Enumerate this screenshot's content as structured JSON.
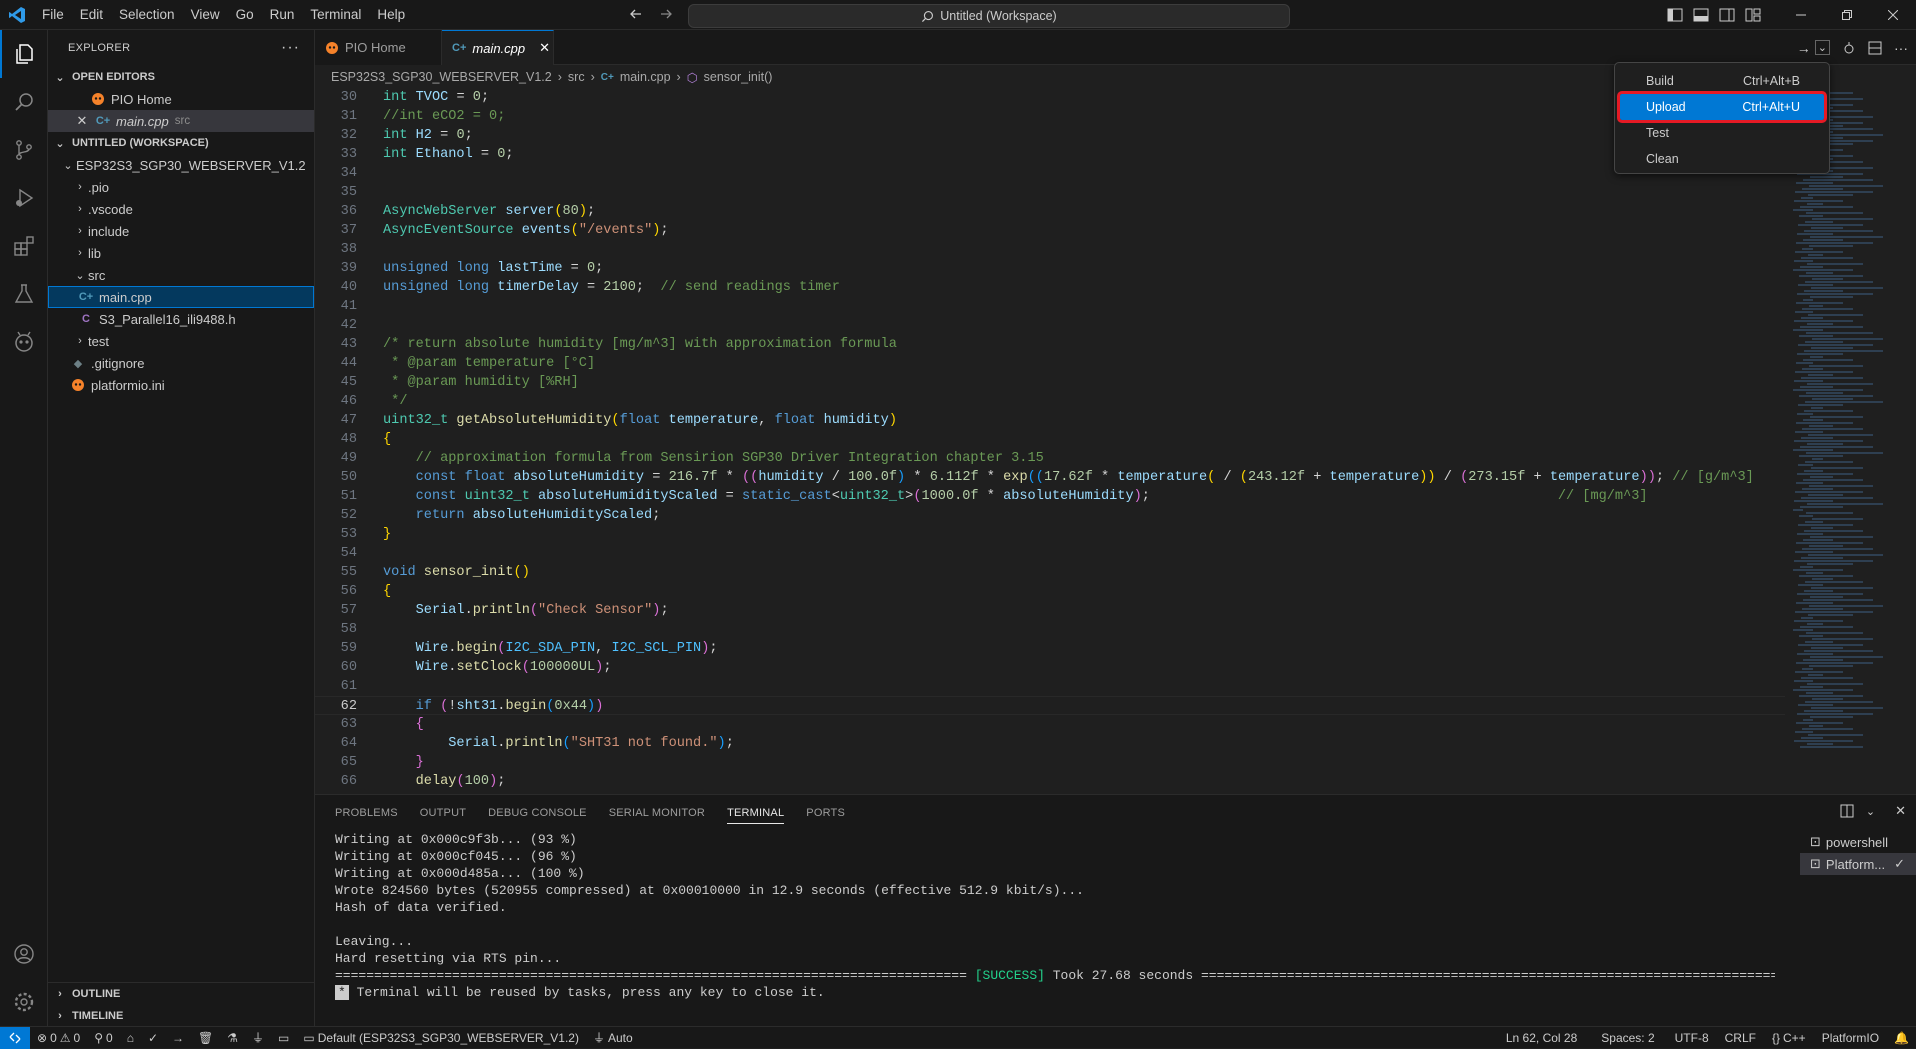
{
  "titlebar": {
    "menus": [
      "File",
      "Edit",
      "Selection",
      "View",
      "Go",
      "Run",
      "Terminal",
      "Help"
    ],
    "search_text": "Untitled (Workspace)"
  },
  "sidebar": {
    "title": "EXPLORER",
    "open_editors": {
      "label": "OPEN EDITORS",
      "items": [
        {
          "name": "PIO Home",
          "desc": ""
        },
        {
          "name": "main.cpp",
          "desc": "src"
        }
      ]
    },
    "workspace": {
      "label": "UNTITLED (WORKSPACE)",
      "project": "ESP32S3_SGP30_WEBSERVER_V1.2",
      "items": [
        ".pio",
        ".vscode",
        "include",
        "lib",
        "src",
        "main.cpp",
        "S3_Parallel16_ili9488.h",
        "test",
        ".gitignore",
        "platformio.ini"
      ]
    },
    "outline": "OUTLINE",
    "timeline": "TIMELINE"
  },
  "tabs": [
    {
      "label": "PIO Home"
    },
    {
      "label": "main.cpp"
    }
  ],
  "breadcrumb": [
    "ESP32S3_SGP30_WEBSERVER_V1.2",
    "src",
    "main.cpp",
    "sensor_init()"
  ],
  "dropdown": {
    "items": [
      {
        "label": "Build",
        "shortcut": "Ctrl+Alt+B"
      },
      {
        "label": "Upload",
        "shortcut": "Ctrl+Alt+U"
      },
      {
        "label": "Test",
        "shortcut": ""
      },
      {
        "label": "Clean",
        "shortcut": ""
      }
    ]
  },
  "editor": {
    "current_line": 62,
    "lines": [
      {
        "n": 30,
        "tokens": [
          [
            "ty",
            "int "
          ],
          [
            "vr",
            "TVOC"
          ],
          [
            "pu",
            " = "
          ],
          [
            "nm",
            "0"
          ],
          [
            "pu",
            ";"
          ]
        ]
      },
      {
        "n": 31,
        "tokens": [
          [
            "cm",
            "//int eCO2 = 0;"
          ]
        ]
      },
      {
        "n": 32,
        "tokens": [
          [
            "ty",
            "int "
          ],
          [
            "vr",
            "H2"
          ],
          [
            "pu",
            " = "
          ],
          [
            "nm",
            "0"
          ],
          [
            "pu",
            ";"
          ]
        ]
      },
      {
        "n": 33,
        "tokens": [
          [
            "ty",
            "int "
          ],
          [
            "vr",
            "Ethanol"
          ],
          [
            "pu",
            " = "
          ],
          [
            "nm",
            "0"
          ],
          [
            "pu",
            ";"
          ]
        ]
      },
      {
        "n": 34,
        "tokens": []
      },
      {
        "n": 35,
        "tokens": []
      },
      {
        "n": 36,
        "tokens": [
          [
            "ty",
            "AsyncWebServer "
          ],
          [
            "vr",
            "server"
          ],
          [
            "br",
            "("
          ],
          [
            "nm",
            "80"
          ],
          [
            "br",
            ")"
          ],
          [
            "pu",
            ";"
          ]
        ]
      },
      {
        "n": 37,
        "tokens": [
          [
            "ty",
            "AsyncEventSource "
          ],
          [
            "vr",
            "events"
          ],
          [
            "br",
            "("
          ],
          [
            "st",
            "\"/events\""
          ],
          [
            "br",
            ")"
          ],
          [
            "pu",
            ";"
          ]
        ]
      },
      {
        "n": 38,
        "tokens": []
      },
      {
        "n": 39,
        "tokens": [
          [
            "kw",
            "unsigned long "
          ],
          [
            "vr",
            "lastTime"
          ],
          [
            "pu",
            " = "
          ],
          [
            "nm",
            "0"
          ],
          [
            "pu",
            ";"
          ]
        ]
      },
      {
        "n": 40,
        "tokens": [
          [
            "kw",
            "unsigned long "
          ],
          [
            "vr",
            "timerDelay"
          ],
          [
            "pu",
            " = "
          ],
          [
            "nm",
            "2100"
          ],
          [
            "pu",
            ";  "
          ],
          [
            "cm",
            "// send readings timer"
          ]
        ]
      },
      {
        "n": 41,
        "tokens": []
      },
      {
        "n": 42,
        "tokens": []
      },
      {
        "n": 43,
        "tokens": [
          [
            "cm",
            "/* return absolute humidity [mg/m^3] with approximation formula"
          ]
        ]
      },
      {
        "n": 44,
        "tokens": [
          [
            "cm",
            " * @param temperature [°C]"
          ]
        ]
      },
      {
        "n": 45,
        "tokens": [
          [
            "cm",
            " * @param humidity [%RH]"
          ]
        ]
      },
      {
        "n": 46,
        "tokens": [
          [
            "cm",
            " */"
          ]
        ]
      },
      {
        "n": 47,
        "tokens": [
          [
            "ty",
            "uint32_t "
          ],
          [
            "fn",
            "getAbsoluteHumidity"
          ],
          [
            "br",
            "("
          ],
          [
            "kw",
            "float "
          ],
          [
            "vr",
            "temperature"
          ],
          [
            "pu",
            ", "
          ],
          [
            "kw",
            "float "
          ],
          [
            "vr",
            "humidity"
          ],
          [
            "br",
            ")"
          ]
        ]
      },
      {
        "n": 48,
        "tokens": [
          [
            "br",
            "{"
          ]
        ]
      },
      {
        "n": 49,
        "tokens": [
          [
            "pu",
            "    "
          ],
          [
            "cm",
            "// approximation formula from Sensirion SGP30 Driver Integration chapter 3.15"
          ]
        ]
      },
      {
        "n": 50,
        "tokens": [
          [
            "pu",
            "    "
          ],
          [
            "kw",
            "const float "
          ],
          [
            "vr",
            "absoluteHumidity"
          ],
          [
            "pu",
            " = "
          ],
          [
            "nm",
            "216.7f"
          ],
          [
            "pu",
            " * "
          ],
          [
            "br2",
            "(("
          ],
          [
            "vr",
            "humidity"
          ],
          [
            "pu",
            " / "
          ],
          [
            "nm",
            "100.0f"
          ],
          [
            "br3",
            ")"
          ],
          [
            "pu",
            " * "
          ],
          [
            "nm",
            "6.112f"
          ],
          [
            "pu",
            " * "
          ],
          [
            "fn",
            "exp"
          ],
          [
            "br3",
            "(("
          ],
          [
            "nm",
            "17.62f"
          ],
          [
            "pu",
            " * "
          ],
          [
            "vr",
            "temperature"
          ],
          [
            "br",
            "("
          ],
          [
            "pu",
            " / "
          ],
          [
            "br",
            "("
          ],
          [
            "nm",
            "243.12f"
          ],
          [
            "pu",
            " + "
          ],
          [
            "vr",
            "temperature"
          ],
          [
            "br",
            "))"
          ],
          [
            "pu",
            " / "
          ],
          [
            "br2",
            "("
          ],
          [
            "nm",
            "273.15f"
          ],
          [
            "pu",
            " + "
          ],
          [
            "vr",
            "temperature"
          ],
          [
            "br2",
            "))"
          ],
          [
            "pu",
            "; "
          ],
          [
            "cm",
            "// [g/m^3]"
          ]
        ]
      },
      {
        "n": 51,
        "tokens": [
          [
            "pu",
            "    "
          ],
          [
            "kw",
            "const "
          ],
          [
            "ty",
            "uint32_t "
          ],
          [
            "vr",
            "absoluteHumidityScaled"
          ],
          [
            "pu",
            " = "
          ],
          [
            "kw",
            "static_cast"
          ],
          [
            "pu",
            "<"
          ],
          [
            "ty",
            "uint32_t"
          ],
          [
            "pu",
            ">"
          ],
          [
            "br2",
            "("
          ],
          [
            "nm",
            "1000.0f"
          ],
          [
            "pu",
            " * "
          ],
          [
            "vr",
            "absoluteHumidity"
          ],
          [
            "br2",
            ")"
          ],
          [
            "pu",
            ";                                                  "
          ],
          [
            "cm",
            "// [mg/m^3]"
          ]
        ]
      },
      {
        "n": 52,
        "tokens": [
          [
            "pu",
            "    "
          ],
          [
            "kw",
            "return "
          ],
          [
            "vr",
            "absoluteHumidityScaled"
          ],
          [
            "pu",
            ";"
          ]
        ]
      },
      {
        "n": 53,
        "tokens": [
          [
            "br",
            "}"
          ]
        ]
      },
      {
        "n": 54,
        "tokens": []
      },
      {
        "n": 55,
        "tokens": [
          [
            "kw",
            "void "
          ],
          [
            "fn",
            "sensor_init"
          ],
          [
            "br",
            "()"
          ]
        ]
      },
      {
        "n": 56,
        "tokens": [
          [
            "br",
            "{"
          ]
        ]
      },
      {
        "n": 57,
        "tokens": [
          [
            "pu",
            "    "
          ],
          [
            "vr",
            "Serial"
          ],
          [
            "pu",
            "."
          ],
          [
            "fn",
            "println"
          ],
          [
            "br2",
            "("
          ],
          [
            "st",
            "\"Check Sensor\""
          ],
          [
            "br2",
            ")"
          ],
          [
            "pu",
            ";"
          ]
        ]
      },
      {
        "n": 58,
        "tokens": []
      },
      {
        "n": 59,
        "tokens": [
          [
            "pu",
            "    "
          ],
          [
            "vr",
            "Wire"
          ],
          [
            "pu",
            "."
          ],
          [
            "fn",
            "begin"
          ],
          [
            "br2",
            "("
          ],
          [
            "mc",
            "I2C_SDA_PIN"
          ],
          [
            "pu",
            ", "
          ],
          [
            "mc",
            "I2C_SCL_PIN"
          ],
          [
            "br2",
            ")"
          ],
          [
            "pu",
            ";"
          ]
        ]
      },
      {
        "n": 60,
        "tokens": [
          [
            "pu",
            "    "
          ],
          [
            "vr",
            "Wire"
          ],
          [
            "pu",
            "."
          ],
          [
            "fn",
            "setClock"
          ],
          [
            "br2",
            "("
          ],
          [
            "nm",
            "100000UL"
          ],
          [
            "br2",
            ")"
          ],
          [
            "pu",
            ";"
          ]
        ]
      },
      {
        "n": 61,
        "tokens": []
      },
      {
        "n": 62,
        "tokens": [
          [
            "pu",
            "    "
          ],
          [
            "kw",
            "if "
          ],
          [
            "br2",
            "("
          ],
          [
            "pu",
            "!"
          ],
          [
            "vr",
            "sht31"
          ],
          [
            "pu",
            "."
          ],
          [
            "fn",
            "begin"
          ],
          [
            "br3",
            "("
          ],
          [
            "nm",
            "0x44"
          ],
          [
            "br3",
            ")"
          ],
          [
            "br2",
            ")"
          ]
        ]
      },
      {
        "n": 63,
        "tokens": [
          [
            "pu",
            "    "
          ],
          [
            "br2",
            "{"
          ]
        ]
      },
      {
        "n": 64,
        "tokens": [
          [
            "pu",
            "        "
          ],
          [
            "vr",
            "Serial"
          ],
          [
            "pu",
            "."
          ],
          [
            "fn",
            "println"
          ],
          [
            "br3",
            "("
          ],
          [
            "st",
            "\"SHT31 not found.\""
          ],
          [
            "br3",
            ")"
          ],
          [
            "pu",
            ";"
          ]
        ]
      },
      {
        "n": 65,
        "tokens": [
          [
            "pu",
            "    "
          ],
          [
            "br2",
            "}"
          ]
        ]
      },
      {
        "n": 66,
        "tokens": [
          [
            "pu",
            "    "
          ],
          [
            "fn",
            "delay"
          ],
          [
            "br2",
            "("
          ],
          [
            "nm",
            "100"
          ],
          [
            "br2",
            ")"
          ],
          [
            "pu",
            ";"
          ]
        ]
      }
    ]
  },
  "panel": {
    "tabs": [
      "PROBLEMS",
      "OUTPUT",
      "DEBUG CONSOLE",
      "SERIAL MONITOR",
      "TERMINAL",
      "PORTS"
    ],
    "active_tab": "TERMINAL",
    "terminal_lines": [
      "Writing at 0x000c9f3b... (93 %)",
      "Writing at 0x000cf045... (96 %)",
      "Writing at 0x000d485a... (100 %)",
      "Wrote 824560 bytes (520955 compressed) at 0x00010000 in 12.9 seconds (effective 512.9 kbit/s)...",
      "Hash of data verified.",
      "",
      "Leaving...",
      "Hard resetting via RTS pin..."
    ],
    "success_line": {
      "left": "================================================================================= ",
      "tag": "[SUCCESS]",
      "right": " Took 27.68 seconds =================================================================================="
    },
    "reuse_msg": " Terminal will be reused by tasks, press any key to close it.",
    "terminals": [
      "powershell",
      "Platform..."
    ]
  },
  "statusbar": {
    "errors": "0",
    "warnings": "0",
    "ports": "0",
    "env": "Default (ESP32S3_SGP30_WEBSERVER_V1.2)",
    "auto": "Auto",
    "position": "Ln 62, Col 28",
    "spaces": "Spaces: 2",
    "encoding": "UTF-8",
    "eol": "CRLF",
    "language": "C++",
    "platform": "PlatformIO"
  },
  "colors": {
    "accent": "#0078d4",
    "highlight_border": "#e51a25",
    "success": "#23d18b"
  }
}
